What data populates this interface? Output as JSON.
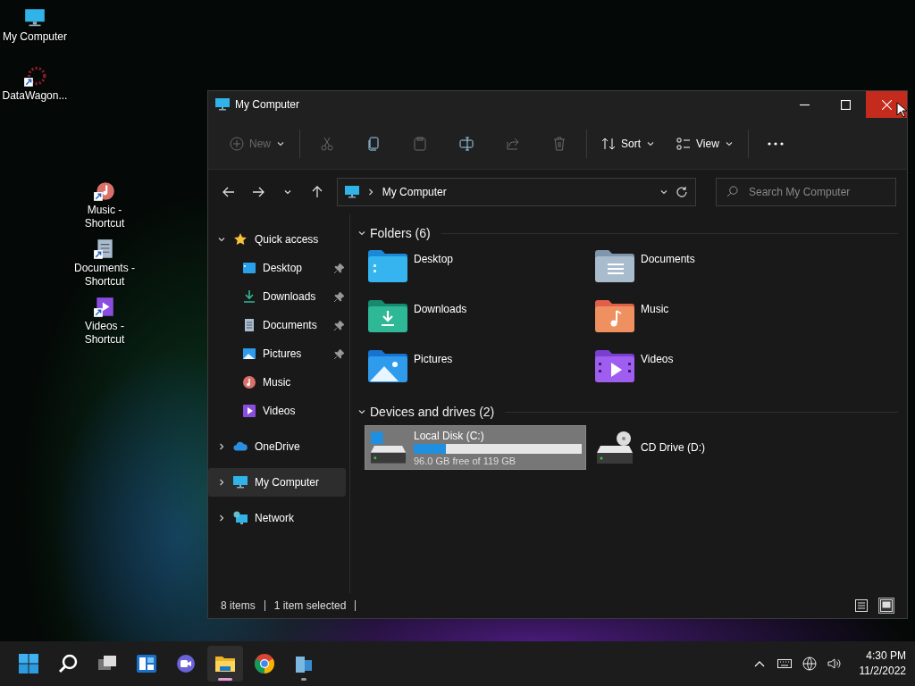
{
  "desktop_icons": [
    {
      "label": "My Computer",
      "kind": "computer",
      "shortcut": false
    },
    {
      "label": "DataWagon...",
      "kind": "app",
      "shortcut": true
    },
    {
      "label": "Music - Shortcut",
      "kind": "music",
      "shortcut": true
    },
    {
      "label": "Documents - Shortcut",
      "kind": "documents",
      "shortcut": true
    },
    {
      "label": "Videos - Shortcut",
      "kind": "videos",
      "shortcut": true
    }
  ],
  "window": {
    "title": "My Computer",
    "toolbar": {
      "groups": [
        [
          {
            "kind": "new",
            "label": "New",
            "disabled": true
          }
        ],
        [
          {
            "kind": "cut",
            "disabled": true
          },
          {
            "kind": "copy",
            "disabled": false
          },
          {
            "kind": "paste",
            "disabled": true
          },
          {
            "kind": "rename",
            "disabled": false
          },
          {
            "kind": "share",
            "disabled": true
          },
          {
            "kind": "delete",
            "disabled": true
          }
        ],
        [
          {
            "kind": "sort",
            "label": "Sort",
            "disabled": false
          },
          {
            "kind": "view",
            "label": "View",
            "disabled": false
          }
        ],
        [
          {
            "kind": "more",
            "disabled": false
          }
        ]
      ]
    },
    "address": {
      "path": "My Computer"
    },
    "search": {
      "placeholder": "Search My Computer"
    },
    "sidebar": {
      "items": [
        {
          "label": "Quick access",
          "kind": "star",
          "expanded": true,
          "selected": false,
          "children": [
            {
              "label": "Desktop",
              "kind": "desktop",
              "pinned": true,
              "selected": false
            },
            {
              "label": "Downloads",
              "kind": "downloads",
              "pinned": true,
              "selected": false
            },
            {
              "label": "Documents",
              "kind": "documents",
              "pinned": true,
              "selected": false
            },
            {
              "label": "Pictures",
              "kind": "pictures",
              "pinned": true,
              "selected": false
            },
            {
              "label": "Music",
              "kind": "music",
              "pinned": false,
              "selected": false
            },
            {
              "label": "Videos",
              "kind": "videos",
              "pinned": false,
              "selected": false
            }
          ]
        },
        {
          "label": "OneDrive",
          "kind": "cloud",
          "expanded": false,
          "selected": false
        },
        {
          "label": "My Computer",
          "kind": "computer",
          "expanded": false,
          "selected": true
        },
        {
          "label": "Network",
          "kind": "network",
          "expanded": false,
          "selected": false
        }
      ]
    },
    "sections": [
      {
        "title": "Folders (6)",
        "expanded": true,
        "items": [
          {
            "label": "Desktop",
            "kind": "desktop",
            "selected": false
          },
          {
            "label": "Documents",
            "kind": "documents",
            "selected": false
          },
          {
            "label": "Downloads",
            "kind": "downloads",
            "selected": false
          },
          {
            "label": "Music",
            "kind": "music",
            "selected": false
          },
          {
            "label": "Pictures",
            "kind": "pictures",
            "selected": false
          },
          {
            "label": "Videos",
            "kind": "videos",
            "selected": false
          }
        ]
      },
      {
        "title": "Devices and drives (2)",
        "expanded": true,
        "items": [
          {
            "label": "Local Disk (C:)",
            "kind": "disk",
            "selected": true,
            "level": 0.19,
            "free": "96.0 GB free of 119 GB"
          },
          {
            "label": "CD Drive (D:)",
            "kind": "cd",
            "selected": false
          }
        ]
      }
    ],
    "status_bar": {
      "count": "8 items",
      "selection": "1 item selected",
      "view_modes": [
        {
          "kind": "details",
          "selected": false
        },
        {
          "kind": "tiles",
          "selected": true
        }
      ]
    }
  },
  "taskbar": {
    "apps": [
      {
        "kind": "start",
        "running": false,
        "active": false
      },
      {
        "kind": "search",
        "running": false,
        "active": false
      },
      {
        "kind": "taskview",
        "running": false,
        "active": false
      },
      {
        "kind": "widgets",
        "running": false,
        "active": false
      },
      {
        "kind": "chat",
        "running": false,
        "active": false
      },
      {
        "kind": "explorer",
        "running": true,
        "active": true
      },
      {
        "kind": "chrome",
        "running": false,
        "active": false
      },
      {
        "kind": "app",
        "running": true,
        "active": false
      }
    ],
    "time": "4:30 PM",
    "date": "11/2/2022"
  }
}
